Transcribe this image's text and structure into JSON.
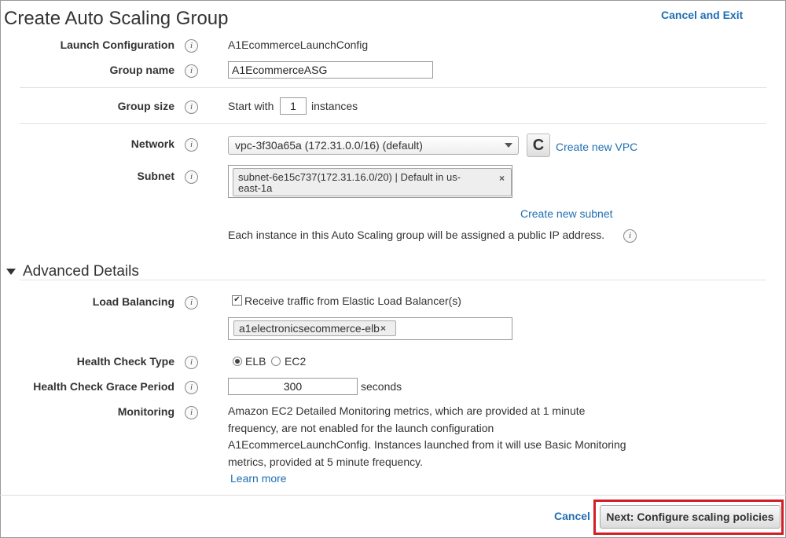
{
  "header": {
    "title": "Create Auto Scaling Group",
    "cancel_exit": "Cancel and Exit"
  },
  "info_glyph": "i",
  "form": {
    "launch_config": {
      "label": "Launch Configuration",
      "value": "A1EcommerceLaunchConfig"
    },
    "group_name": {
      "label": "Group name",
      "value": "A1EcommerceASG"
    },
    "group_size": {
      "label": "Group size",
      "prefix": "Start with",
      "value": "1",
      "suffix": "instances"
    },
    "network": {
      "label": "Network",
      "selected": "vpc-3f30a65a (172.31.0.0/16) (default)",
      "refresh_glyph": "C",
      "create_link": "Create new VPC"
    },
    "subnet": {
      "label": "Subnet",
      "tag_line1": "subnet-6e15c737(172.31.16.0/20) | Default in us-",
      "tag_line2": "east-1a",
      "remove_glyph": "×",
      "create_link": "Create new subnet",
      "note": "Each instance in this Auto Scaling group will be assigned a public IP address."
    }
  },
  "advanced": {
    "title": "Advanced Details",
    "load_balancing": {
      "label": "Load Balancing",
      "checkbox_label": "Receive traffic from Elastic Load Balancer(s)",
      "checked": true,
      "check_glyph": "✔",
      "tag": "a1electronicsecommerce-elb",
      "remove_glyph": "×"
    },
    "health_check_type": {
      "label": "Health Check Type",
      "options": [
        "ELB",
        "EC2"
      ],
      "selected": "ELB"
    },
    "grace_period": {
      "label": "Health Check Grace Period",
      "value": "300",
      "suffix": "seconds"
    },
    "monitoring": {
      "label": "Monitoring",
      "line1": "Amazon EC2 Detailed Monitoring metrics, which are provided at 1 minute",
      "line2": "frequency, are not enabled for the launch configuration",
      "line3": "A1EcommerceLaunchConfig. Instances launched from it will use Basic Monitoring",
      "line4": "metrics, provided at 5 minute frequency.",
      "learn_more": "Learn more"
    }
  },
  "footer": {
    "cancel": "Cancel",
    "next": "Next: Configure scaling policies"
  },
  "colors": {
    "link": "#1f6fb2",
    "highlight": "#d21f26"
  }
}
